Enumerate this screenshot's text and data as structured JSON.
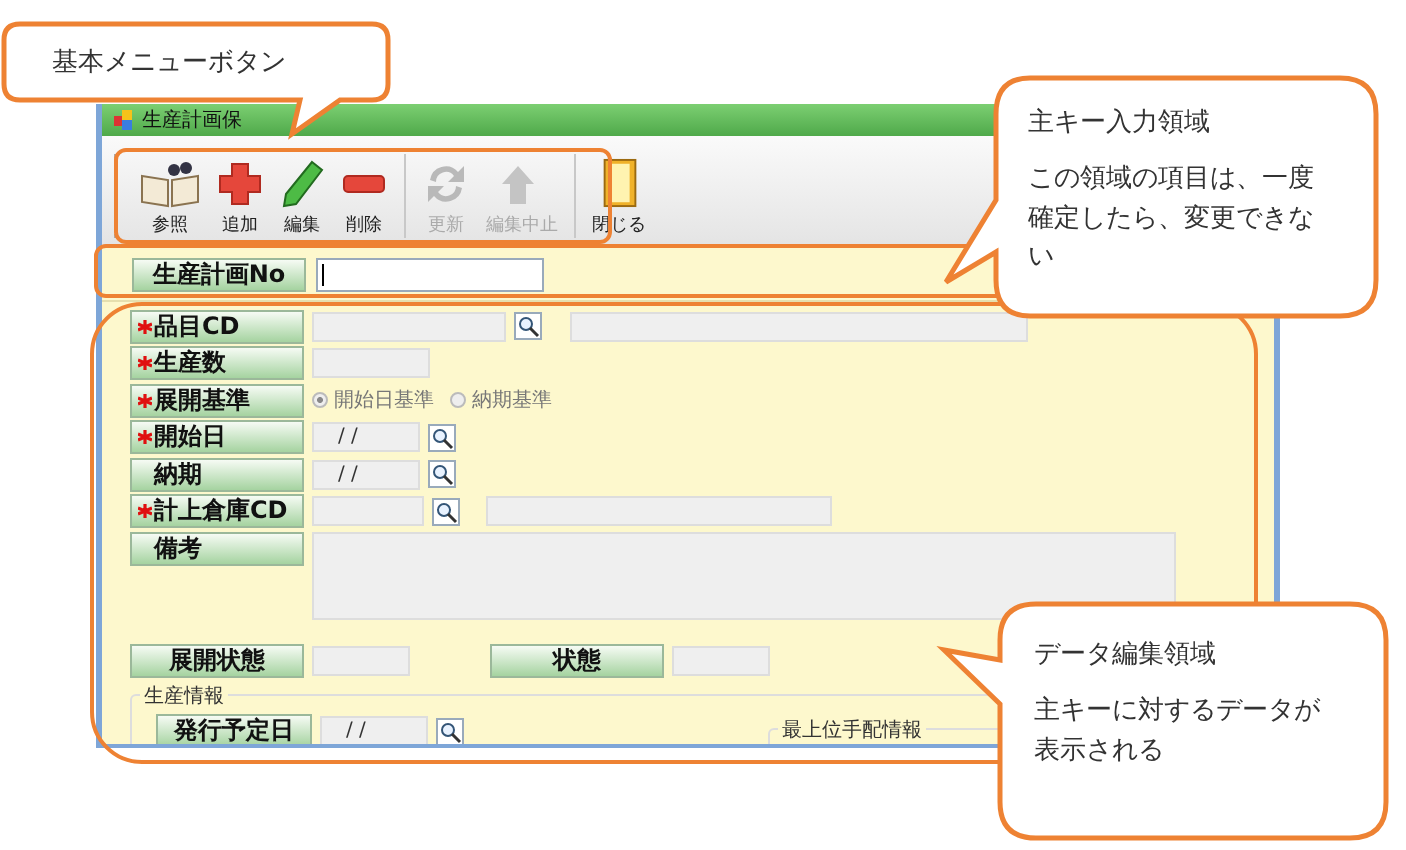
{
  "window": {
    "title": "生産計画保"
  },
  "toolbar": [
    {
      "label": "参照",
      "kind": "book",
      "disabled": false
    },
    {
      "label": "追加",
      "kind": "plus",
      "disabled": false
    },
    {
      "label": "編集",
      "kind": "pencil",
      "disabled": false
    },
    {
      "label": "削除",
      "kind": "minus",
      "disabled": false
    },
    {
      "label": "更新",
      "kind": "refresh",
      "disabled": true
    },
    {
      "label": "編集中止",
      "kind": "undo",
      "disabled": true
    },
    {
      "label": "閉じる",
      "kind": "door",
      "disabled": false
    }
  ],
  "key": {
    "label": "生産計画No"
  },
  "fields": [
    {
      "label": "品目CD",
      "required": true,
      "kind": "lookup"
    },
    {
      "label": "生産数",
      "required": true,
      "kind": "number"
    },
    {
      "label": "展開基準",
      "required": true,
      "kind": "radio",
      "options": [
        {
          "label": "開始日基準",
          "selected": true
        },
        {
          "label": "納期基準",
          "selected": false
        }
      ]
    },
    {
      "label": "開始日",
      "required": true,
      "kind": "date",
      "value": "/ /"
    },
    {
      "label": "納期",
      "required": false,
      "kind": "date",
      "value": "/ /"
    },
    {
      "label": "計上倉庫CD",
      "required": true,
      "kind": "code"
    },
    {
      "label": "備考",
      "required": false,
      "kind": "memo"
    }
  ],
  "status_row": [
    {
      "label": "展開状態"
    },
    {
      "label": "状態"
    }
  ],
  "production_group": {
    "title": "生産情報",
    "label": "発行予定日",
    "value": "/ /",
    "subgroup_title": "最上位手配情報"
  },
  "callouts": [
    {
      "title": "基本メニューボタン"
    },
    {
      "title": "主キー入力領域",
      "body": "この領域の項目は、一度確定したら、変更できない"
    },
    {
      "title": "データ編集領域",
      "body": "主キーに対するデータが表示される"
    }
  ]
}
